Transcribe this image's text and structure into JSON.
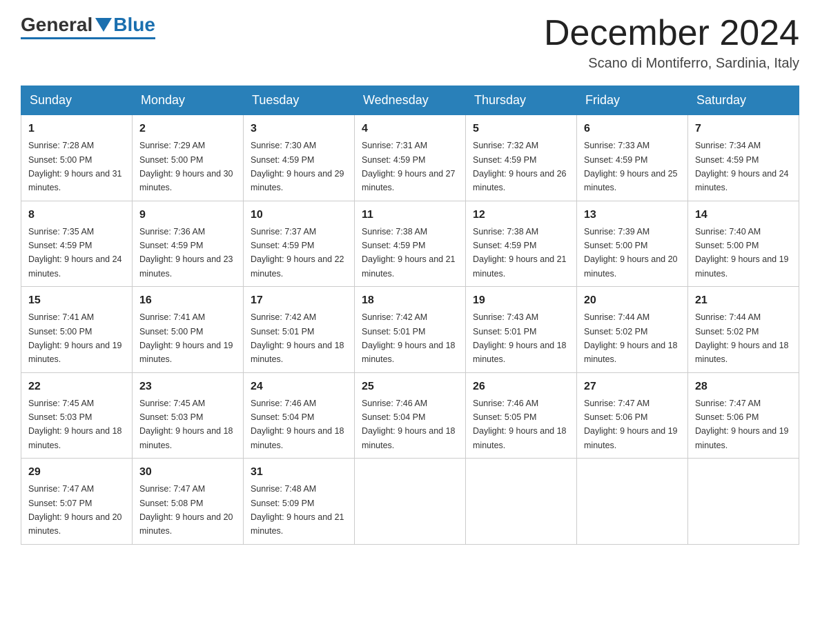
{
  "header": {
    "logo": {
      "general": "General",
      "blue": "Blue"
    },
    "month_title": "December 2024",
    "location": "Scano di Montiferro, Sardinia, Italy"
  },
  "days_of_week": [
    "Sunday",
    "Monday",
    "Tuesday",
    "Wednesday",
    "Thursday",
    "Friday",
    "Saturday"
  ],
  "weeks": [
    [
      {
        "day": "1",
        "sunrise": "7:28 AM",
        "sunset": "5:00 PM",
        "daylight": "9 hours and 31 minutes."
      },
      {
        "day": "2",
        "sunrise": "7:29 AM",
        "sunset": "5:00 PM",
        "daylight": "9 hours and 30 minutes."
      },
      {
        "day": "3",
        "sunrise": "7:30 AM",
        "sunset": "4:59 PM",
        "daylight": "9 hours and 29 minutes."
      },
      {
        "day": "4",
        "sunrise": "7:31 AM",
        "sunset": "4:59 PM",
        "daylight": "9 hours and 27 minutes."
      },
      {
        "day": "5",
        "sunrise": "7:32 AM",
        "sunset": "4:59 PM",
        "daylight": "9 hours and 26 minutes."
      },
      {
        "day": "6",
        "sunrise": "7:33 AM",
        "sunset": "4:59 PM",
        "daylight": "9 hours and 25 minutes."
      },
      {
        "day": "7",
        "sunrise": "7:34 AM",
        "sunset": "4:59 PM",
        "daylight": "9 hours and 24 minutes."
      }
    ],
    [
      {
        "day": "8",
        "sunrise": "7:35 AM",
        "sunset": "4:59 PM",
        "daylight": "9 hours and 24 minutes."
      },
      {
        "day": "9",
        "sunrise": "7:36 AM",
        "sunset": "4:59 PM",
        "daylight": "9 hours and 23 minutes."
      },
      {
        "day": "10",
        "sunrise": "7:37 AM",
        "sunset": "4:59 PM",
        "daylight": "9 hours and 22 minutes."
      },
      {
        "day": "11",
        "sunrise": "7:38 AM",
        "sunset": "4:59 PM",
        "daylight": "9 hours and 21 minutes."
      },
      {
        "day": "12",
        "sunrise": "7:38 AM",
        "sunset": "4:59 PM",
        "daylight": "9 hours and 21 minutes."
      },
      {
        "day": "13",
        "sunrise": "7:39 AM",
        "sunset": "5:00 PM",
        "daylight": "9 hours and 20 minutes."
      },
      {
        "day": "14",
        "sunrise": "7:40 AM",
        "sunset": "5:00 PM",
        "daylight": "9 hours and 19 minutes."
      }
    ],
    [
      {
        "day": "15",
        "sunrise": "7:41 AM",
        "sunset": "5:00 PM",
        "daylight": "9 hours and 19 minutes."
      },
      {
        "day": "16",
        "sunrise": "7:41 AM",
        "sunset": "5:00 PM",
        "daylight": "9 hours and 19 minutes."
      },
      {
        "day": "17",
        "sunrise": "7:42 AM",
        "sunset": "5:01 PM",
        "daylight": "9 hours and 18 minutes."
      },
      {
        "day": "18",
        "sunrise": "7:42 AM",
        "sunset": "5:01 PM",
        "daylight": "9 hours and 18 minutes."
      },
      {
        "day": "19",
        "sunrise": "7:43 AM",
        "sunset": "5:01 PM",
        "daylight": "9 hours and 18 minutes."
      },
      {
        "day": "20",
        "sunrise": "7:44 AM",
        "sunset": "5:02 PM",
        "daylight": "9 hours and 18 minutes."
      },
      {
        "day": "21",
        "sunrise": "7:44 AM",
        "sunset": "5:02 PM",
        "daylight": "9 hours and 18 minutes."
      }
    ],
    [
      {
        "day": "22",
        "sunrise": "7:45 AM",
        "sunset": "5:03 PM",
        "daylight": "9 hours and 18 minutes."
      },
      {
        "day": "23",
        "sunrise": "7:45 AM",
        "sunset": "5:03 PM",
        "daylight": "9 hours and 18 minutes."
      },
      {
        "day": "24",
        "sunrise": "7:46 AM",
        "sunset": "5:04 PM",
        "daylight": "9 hours and 18 minutes."
      },
      {
        "day": "25",
        "sunrise": "7:46 AM",
        "sunset": "5:04 PM",
        "daylight": "9 hours and 18 minutes."
      },
      {
        "day": "26",
        "sunrise": "7:46 AM",
        "sunset": "5:05 PM",
        "daylight": "9 hours and 18 minutes."
      },
      {
        "day": "27",
        "sunrise": "7:47 AM",
        "sunset": "5:06 PM",
        "daylight": "9 hours and 19 minutes."
      },
      {
        "day": "28",
        "sunrise": "7:47 AM",
        "sunset": "5:06 PM",
        "daylight": "9 hours and 19 minutes."
      }
    ],
    [
      {
        "day": "29",
        "sunrise": "7:47 AM",
        "sunset": "5:07 PM",
        "daylight": "9 hours and 20 minutes."
      },
      {
        "day": "30",
        "sunrise": "7:47 AM",
        "sunset": "5:08 PM",
        "daylight": "9 hours and 20 minutes."
      },
      {
        "day": "31",
        "sunrise": "7:48 AM",
        "sunset": "5:09 PM",
        "daylight": "9 hours and 21 minutes."
      },
      null,
      null,
      null,
      null
    ]
  ]
}
